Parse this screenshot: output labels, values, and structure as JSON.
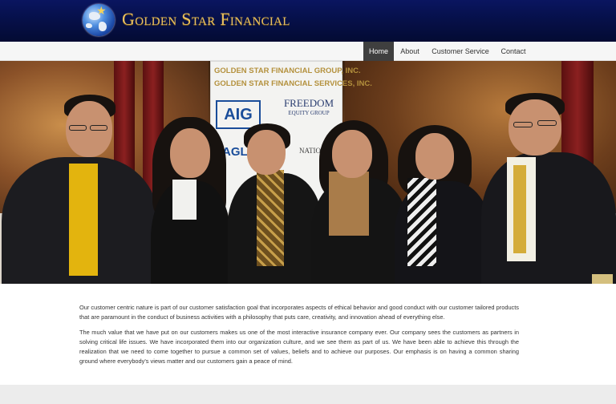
{
  "brand": {
    "name": "Golden Star Financial",
    "logo_icon": "globe-star-logo",
    "header_color": "#06104a",
    "gold_color": "#e8c062"
  },
  "nav": {
    "items": [
      {
        "label": "Home",
        "active": true
      },
      {
        "label": "About",
        "active": false
      },
      {
        "label": "Customer Service",
        "active": false
      },
      {
        "label": "Contact",
        "active": false
      }
    ]
  },
  "hero": {
    "banner_line_1": "GOLDEN STAR FINANCIAL GROUP, INC.",
    "banner_line_2": "GOLDEN STAR FINANCIAL SERVICES, INC.",
    "partner_1": "AIG",
    "partner_2_main": "FREEDOM",
    "partner_2_sub": "EQUITY GROUP",
    "partner_3": "AGLA",
    "partner_4": "NATIONAL"
  },
  "content": {
    "paragraph_1": "Our customer centric nature is part of our customer satisfaction goal that incorporates aspects of ethical behavior and good conduct with our customer tailored products that are paramount in the conduct of business activities with a philosophy that puts care, creativity, and innovation ahead of everything else.",
    "paragraph_2": "The much value that we have put on our customers makes us one of the most interactive insurance company ever. Our company sees the customers as partners in solving critical life issues. We have incorporated them into our organization culture, and we see them as part of us. We have been able to achieve this through the realization that we need to come together to pursue a common set of values, beliefs and to achieve our purposes. Our emphasis is on having a common sharing ground where everybody's views matter and our customers gain a peace of mind."
  }
}
